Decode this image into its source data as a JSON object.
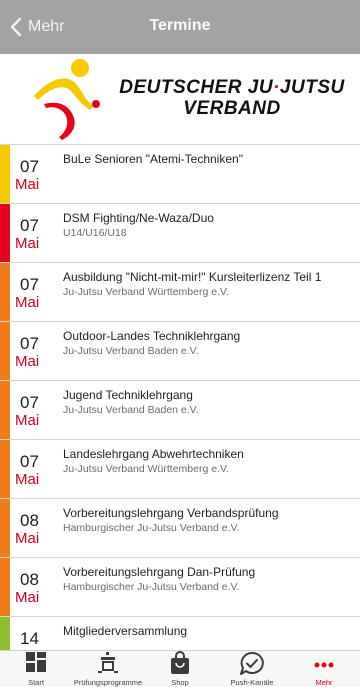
{
  "navbar": {
    "back_label": "Mehr",
    "title": "Termine"
  },
  "brand": {
    "line1_a": "DEUTSCHER JU",
    "line1_dot": "·",
    "line1_b": "JUTSU",
    "line2": "VERBAND"
  },
  "colors": {
    "yellow": "#f6c800",
    "red": "#e3051b",
    "orange": "#f07d19",
    "green": "#8cbd2e",
    "month": "#d0021b"
  },
  "events": [
    {
      "day": "07",
      "month": "Mai",
      "title": "BuLe Senioren \"Atemi-Techniken\"",
      "org": "",
      "color": "yellow"
    },
    {
      "day": "07",
      "month": "Mai",
      "title": "DSM Fighting/Ne-Waza/Duo",
      "org": "U14/U16/U18",
      "color": "red"
    },
    {
      "day": "07",
      "month": "Mai",
      "title": "Ausbildung \"Nicht-mit-mir!\" Kursleiterlizenz Teil 1",
      "org": "Ju-Jutsu Verband Württemberg e.V.",
      "color": "orange"
    },
    {
      "day": "07",
      "month": "Mai",
      "title": "Outdoor-Landes Techniklehrgang",
      "org": "Ju-Jutsu Verband Baden e.V.",
      "color": "orange"
    },
    {
      "day": "07",
      "month": "Mai",
      "title": "Jugend Techniklehrgang",
      "org": "Ju-Jutsu Verband Baden e.V.",
      "color": "orange"
    },
    {
      "day": "07",
      "month": "Mai",
      "title": "Landeslehrgang Abwehrtechniken",
      "org": "Ju-Jutsu Verband Württemberg e.V.",
      "color": "orange"
    },
    {
      "day": "08",
      "month": "Mai",
      "title": "Vorbereitungslehrgang Verbandsprüfung",
      "org": "Hamburgischer Ju-Jutsu Verband e.V.",
      "color": "orange"
    },
    {
      "day": "08",
      "month": "Mai",
      "title": "Vorbereitungslehrgang Dan-Prüfung",
      "org": "Hamburgischer Ju-Jutsu Verband e.V.",
      "color": "orange"
    },
    {
      "day": "14",
      "month": "Mai",
      "title": "Mitgliederversammlung",
      "org": "",
      "color": "green"
    }
  ],
  "tabs": [
    {
      "label": "Start",
      "icon": "grid-icon"
    },
    {
      "label": "Prüfungsprogramme",
      "icon": "dojo-icon"
    },
    {
      "label": "Shop",
      "icon": "shopping-bag-icon"
    },
    {
      "label": "Push-Kanäle",
      "icon": "chat-check-icon"
    },
    {
      "label": "Mehr",
      "icon": "more-dots-icon"
    }
  ]
}
